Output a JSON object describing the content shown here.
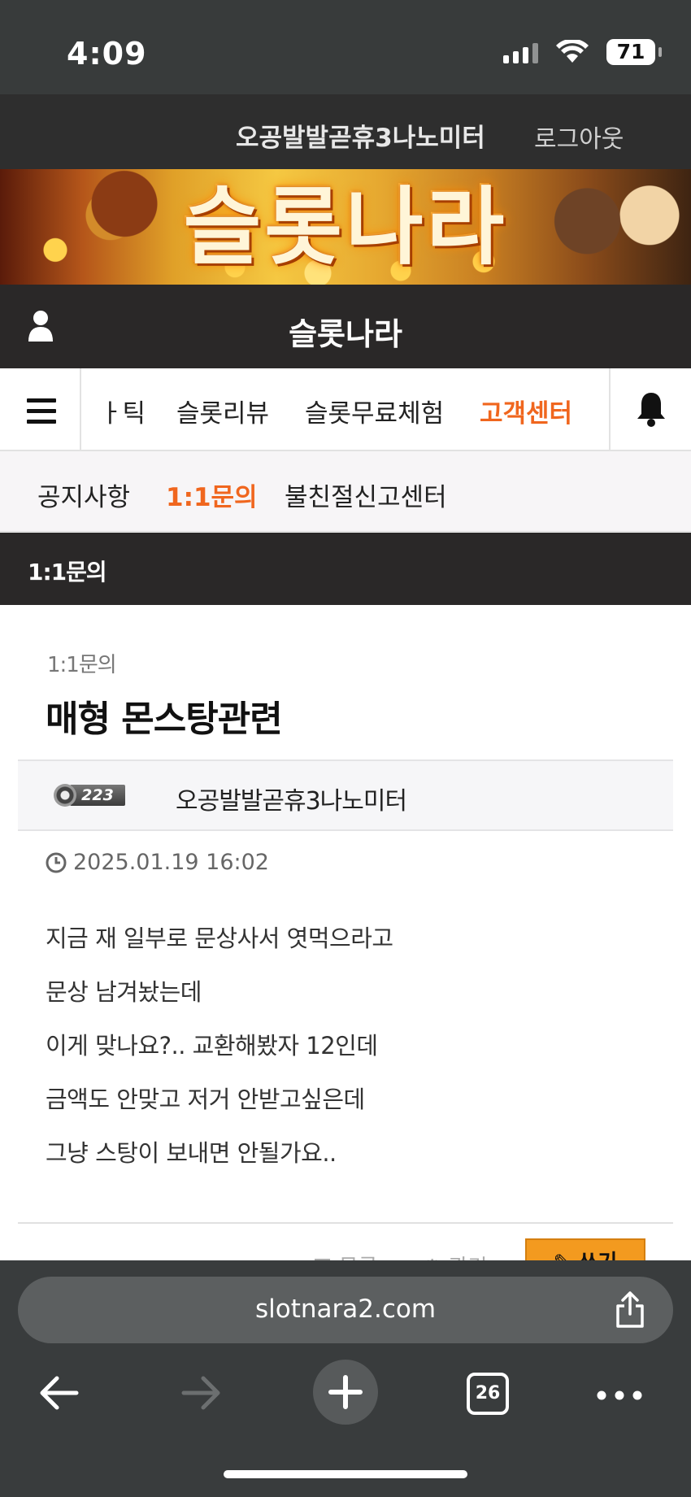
{
  "status_bar": {
    "time": "4:09",
    "battery": "71"
  },
  "site_topbar": {
    "username": "오공발발곧휴3나노미터",
    "logout": "로그아웃"
  },
  "banner": {
    "title": "슬롯나라"
  },
  "site_header": {
    "title": "슬롯나라"
  },
  "main_nav": {
    "items": [
      {
        "label": "ㅏ틱"
      },
      {
        "label": "슬롯리뷰"
      },
      {
        "label": "슬롯무료체험"
      },
      {
        "label": "고객센터",
        "active": true
      }
    ]
  },
  "sub_nav": {
    "items": [
      {
        "label": "공지사항"
      },
      {
        "label": "1:1문의",
        "active": true
      },
      {
        "label": "불친절신고센터"
      }
    ]
  },
  "section": {
    "title": "1:1문의"
  },
  "post": {
    "category": "1:1문의",
    "title": "매형 몬스탕관련",
    "author": {
      "level": "223",
      "name": "오공발발곧휴3나노미터"
    },
    "date": "2025.01.19 16:02",
    "body": [
      "지금 재 일부로 문상사서 엿먹으라고",
      "문상 남겨놨는데",
      "이게 맞나요?.. 교환해봤자 12인데",
      "금액도 안맞고 저거 안받고싶은데",
      "그냥 스탕이 보내면 안될가요.."
    ],
    "actions": {
      "list": "목록",
      "manage": "관리",
      "write": "쓰기"
    }
  },
  "browser": {
    "url": "slotnara2.com",
    "tab_count": "26"
  },
  "colors": {
    "accent": "#f0661e",
    "dark_bar": "#2a2828",
    "write_button": "#f39a1f"
  }
}
